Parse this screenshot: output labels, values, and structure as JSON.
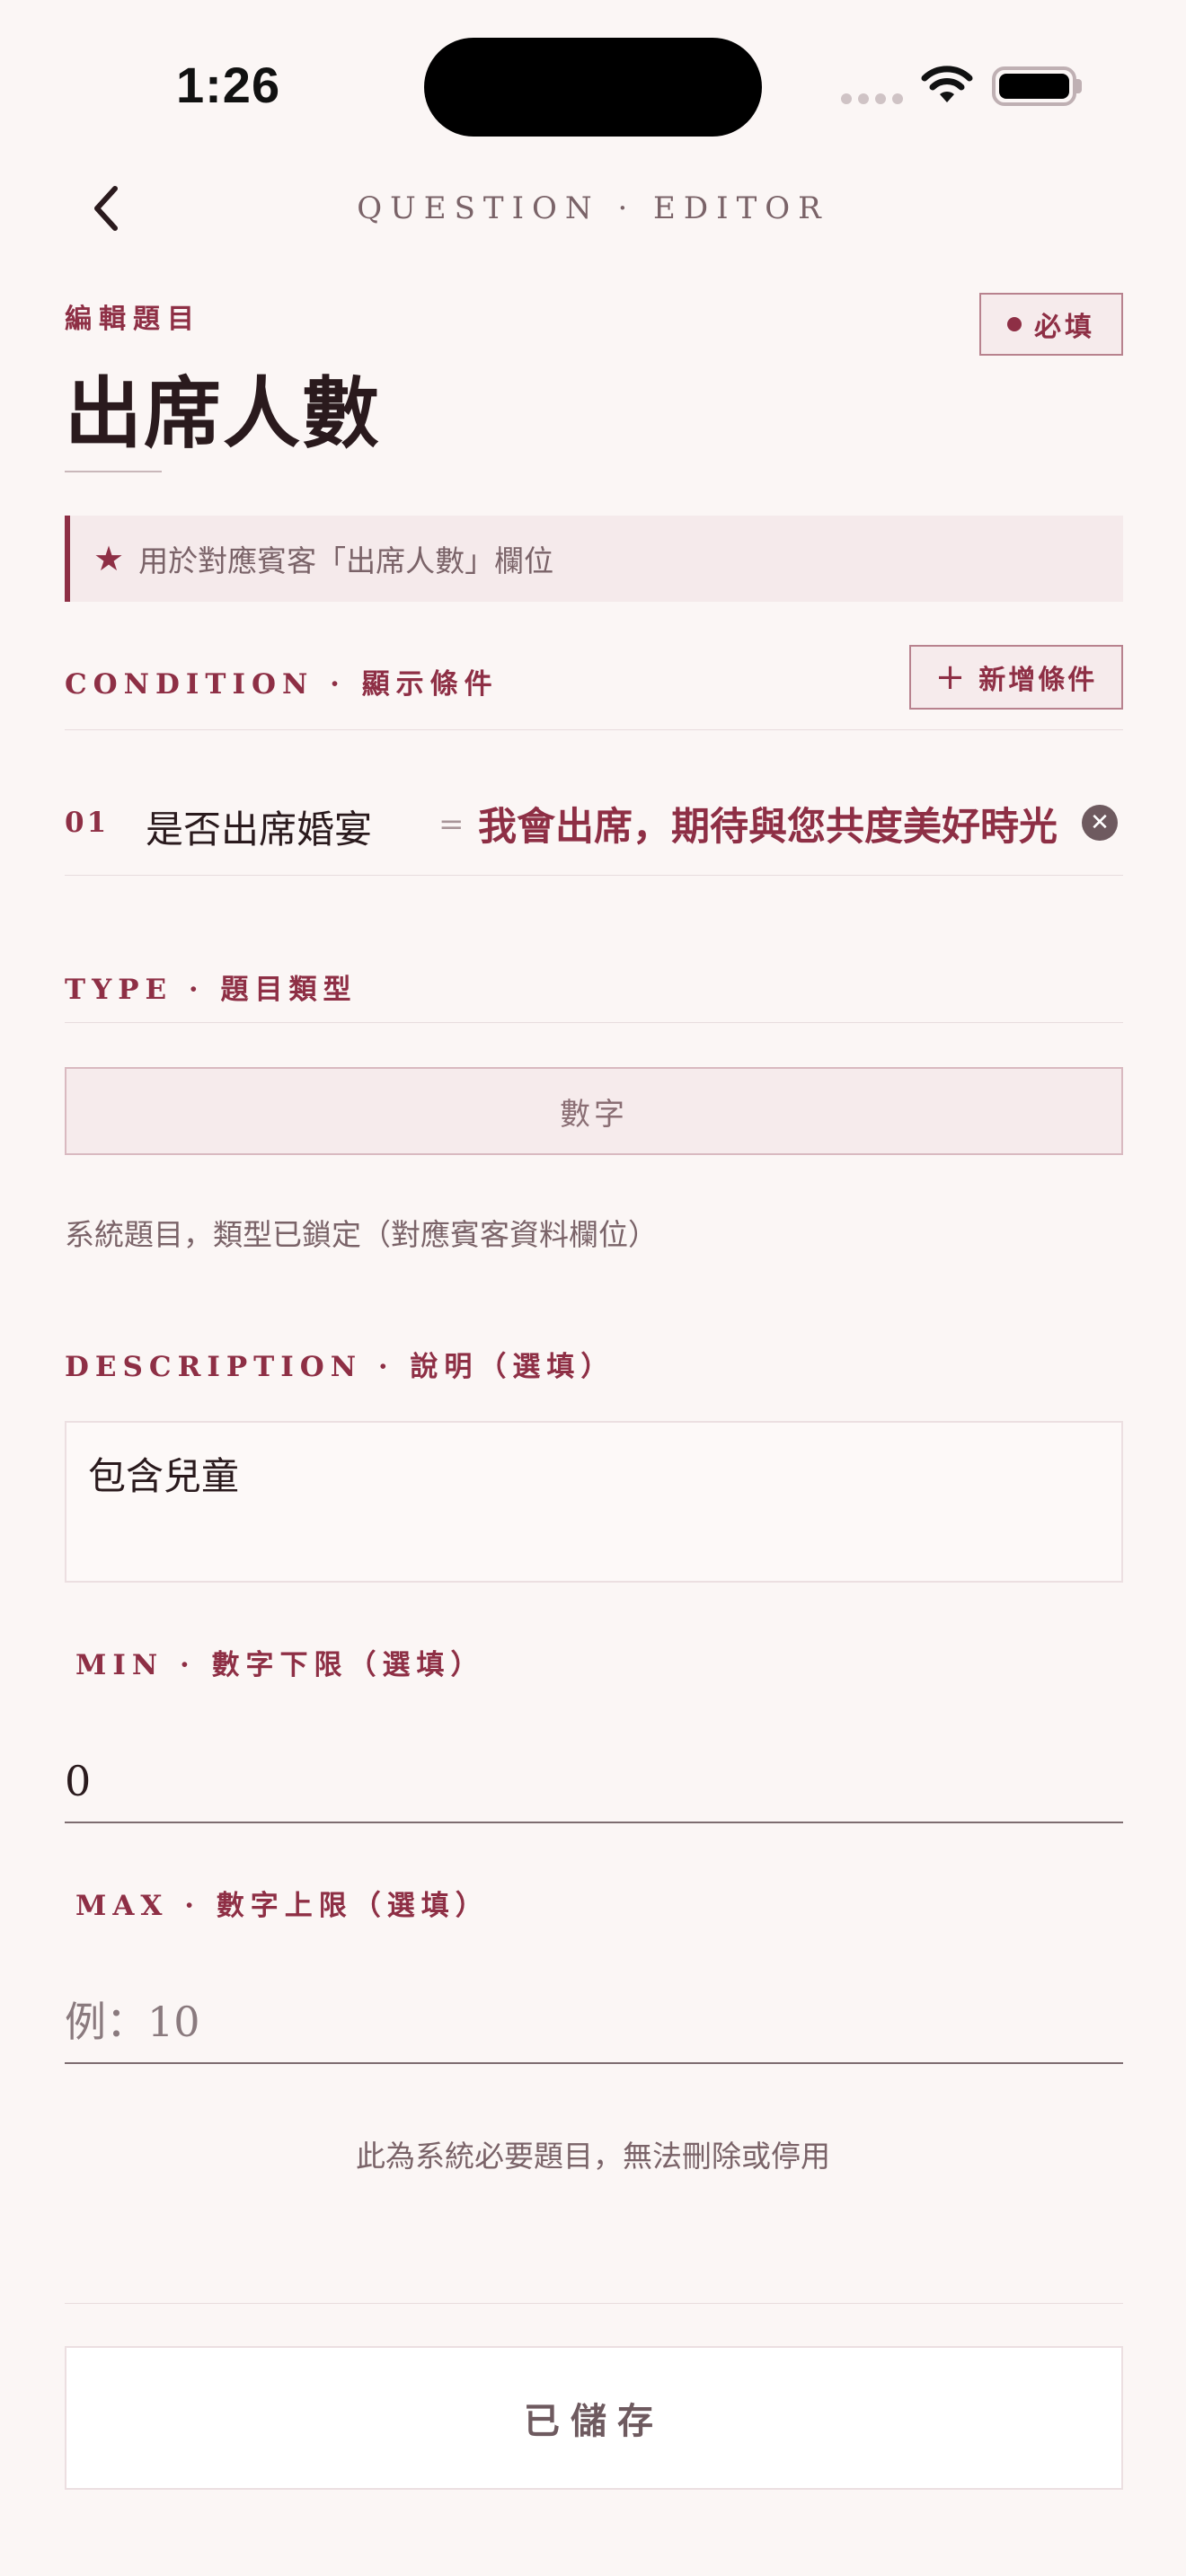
{
  "status_bar": {
    "time": "1:26"
  },
  "nav": {
    "title": "QUESTION · EDITOR"
  },
  "header": {
    "eyebrow": "編輯題目",
    "title": "出席人數",
    "required_badge": "必填"
  },
  "note": {
    "text": "用於對應賓客「出席人數」欄位"
  },
  "condition": {
    "label": "CONDITION · 顯示條件",
    "add_button": "新增條件",
    "items": [
      {
        "index": "01",
        "question": "是否出席婚宴",
        "operator": "=",
        "answer": "我會出席，期待與您共度美好時光"
      }
    ]
  },
  "type": {
    "label": "TYPE · 題目類型",
    "value": "數字",
    "hint": "系統題目，類型已鎖定（對應賓客資料欄位）"
  },
  "description": {
    "label": "DESCRIPTION · 說明（選填）",
    "value": "包含兒童"
  },
  "min": {
    "label": "MIN · 數字下限（選填）",
    "value": "0"
  },
  "max": {
    "label": "MAX · 數字上限（選填）",
    "value": "",
    "placeholder": "例：10"
  },
  "footer_note": "此為系統必要題目，無法刪除或停用",
  "save_button": "已儲存",
  "colors": {
    "accent": "#8e2f45",
    "background": "#fbf6f5",
    "text": "#2a1a1d",
    "muted": "#7a6368"
  }
}
